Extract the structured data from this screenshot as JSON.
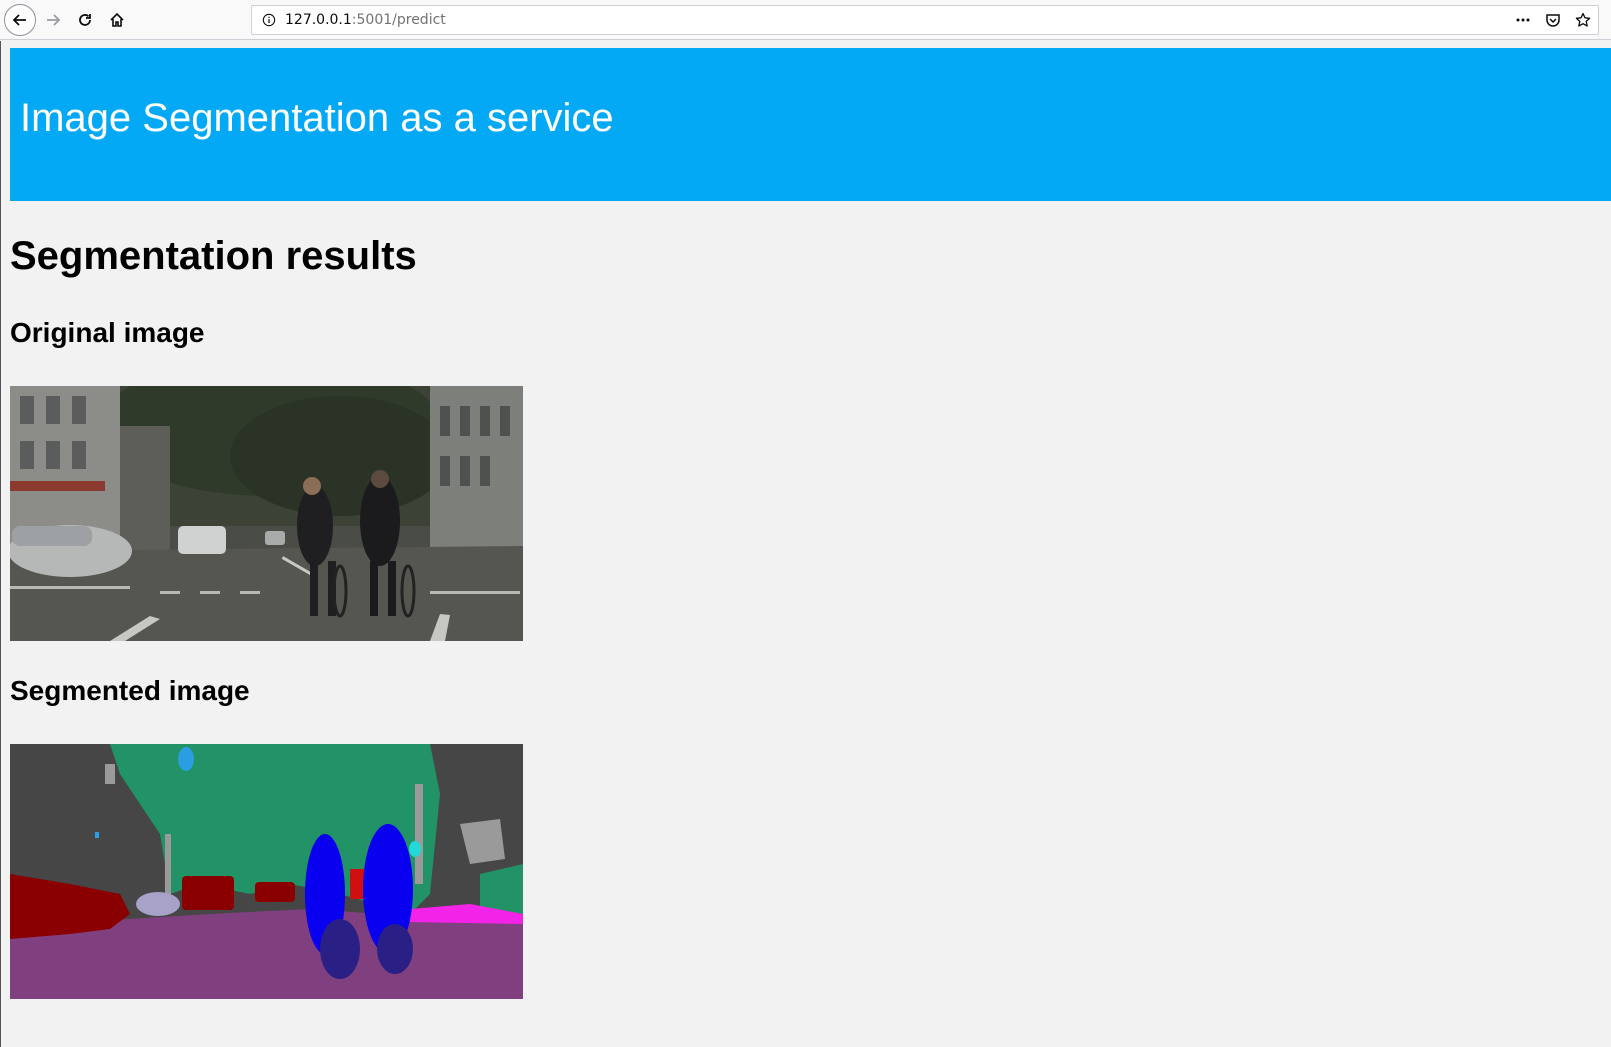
{
  "browser": {
    "url_host": "127.0.0.1",
    "url_path": ":5001/predict",
    "icons": [
      "back-arrow-icon",
      "forward-arrow-icon",
      "reload-icon",
      "home-icon",
      "info-icon",
      "more-icon",
      "pocket-icon",
      "bookmark-star-icon"
    ]
  },
  "header": {
    "title": "Image Segmentation as a service",
    "background_color": "#03a9f4"
  },
  "main": {
    "results_heading": "Segmentation results",
    "original_heading": "Original image",
    "segmented_heading": "Segmented image"
  }
}
